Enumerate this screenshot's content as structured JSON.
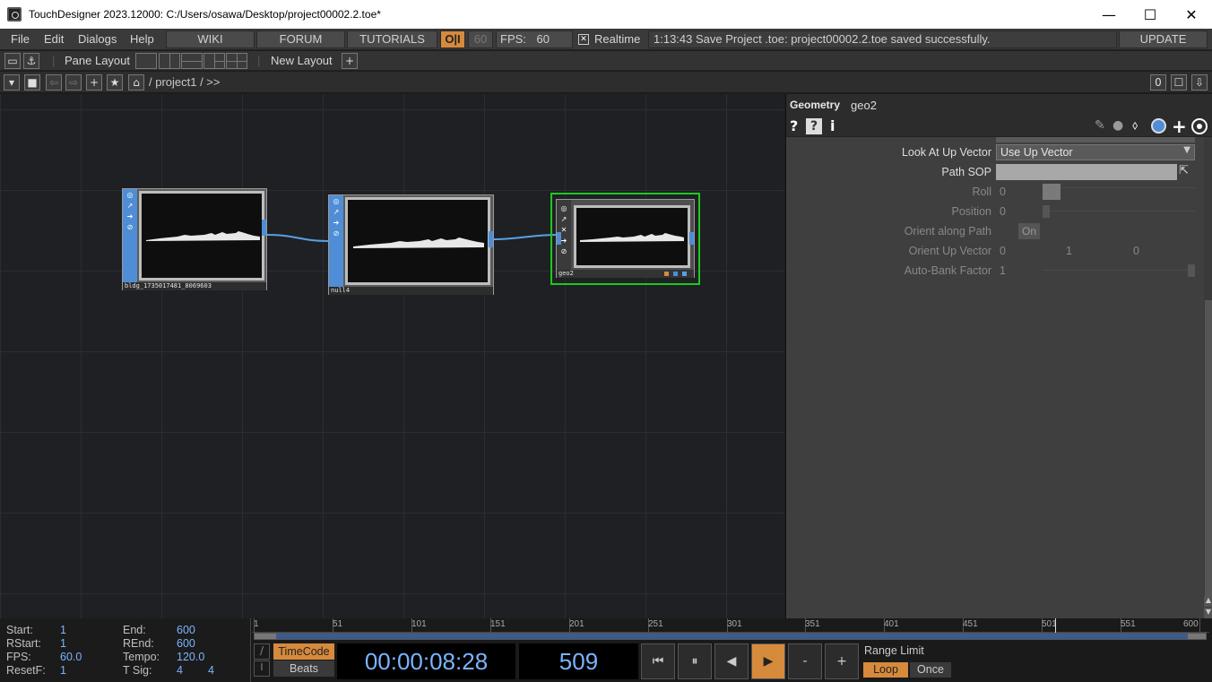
{
  "window": {
    "title": "TouchDesigner 2023.12000: C:/Users/osawa/Desktop/project00002.2.toe*",
    "minimize": "—",
    "maximize": "☐",
    "close": "✕"
  },
  "menubar": {
    "file": "File",
    "edit": "Edit",
    "dialogs": "Dialogs",
    "help": "Help",
    "wiki": "WIKI",
    "forum": "FORUM",
    "tutorials": "TUTORIALS",
    "oi": "O|I",
    "fps_cook": "60",
    "fps_label": "FPS:",
    "fps_value": "60",
    "realtime_check": "✕",
    "realtime": "Realtime",
    "status": "1:13:43 Save Project .toe: project00002.2.toe saved successfully.",
    "update": "UPDATE"
  },
  "layoutbar": {
    "pane_layout": "Pane Layout",
    "new_layout": "New Layout",
    "add": "+"
  },
  "pathbar": {
    "path": "/ project1 / >>",
    "zero": "0"
  },
  "nodes": [
    {
      "label": "bldg_1735017481_8069603"
    },
    {
      "label": "null4"
    },
    {
      "label": "geo2"
    }
  ],
  "params": {
    "op_type": "Geometry",
    "op_name": "geo2",
    "rows": {
      "look_at_up_label": "Look At Up Vector",
      "look_at_up_value": "Use Up Vector",
      "path_sop_label": "Path SOP",
      "roll_label": "Roll",
      "roll_value": "0",
      "position_label": "Position",
      "position_value": "0",
      "orient_path_label": "Orient along Path",
      "orient_path_value": "On",
      "orient_up_label": "Orient Up Vector",
      "orient_up_x": "0",
      "orient_up_y": "1",
      "orient_up_z": "0",
      "auto_bank_label": "Auto-Bank Factor",
      "auto_bank_value": "1"
    }
  },
  "stats": {
    "start_label": "Start:",
    "start": "1",
    "end_label": "End:",
    "end": "600",
    "rstart_label": "RStart:",
    "rstart": "1",
    "rend_label": "REnd:",
    "rend": "600",
    "fps_label": "FPS:",
    "fps": "60.0",
    "tempo_label": "Tempo:",
    "tempo": "120.0",
    "resetf_label": "ResetF:",
    "resetf": "1",
    "tsig_label": "T Sig:",
    "tsig_a": "4",
    "tsig_b": "4"
  },
  "timeline": {
    "ticks": [
      "1",
      "51",
      "101",
      "151",
      "201",
      "251",
      "301",
      "351",
      "401",
      "451",
      "501",
      "551",
      "600"
    ],
    "timecode_btn": "TimeCode",
    "beats_btn": "Beats",
    "timecode": "00:00:08:28",
    "frame": "509",
    "frame_fraction": 0.847,
    "range_limit": "Range Limit",
    "loop": "Loop",
    "once": "Once",
    "minus": "-",
    "plus": "+"
  },
  "colors": {
    "accent_orange": "#d68a3c",
    "node_blue": "#4f8ed6",
    "selected_green": "#1ec81e",
    "link_blue": "#5aa0e6"
  }
}
